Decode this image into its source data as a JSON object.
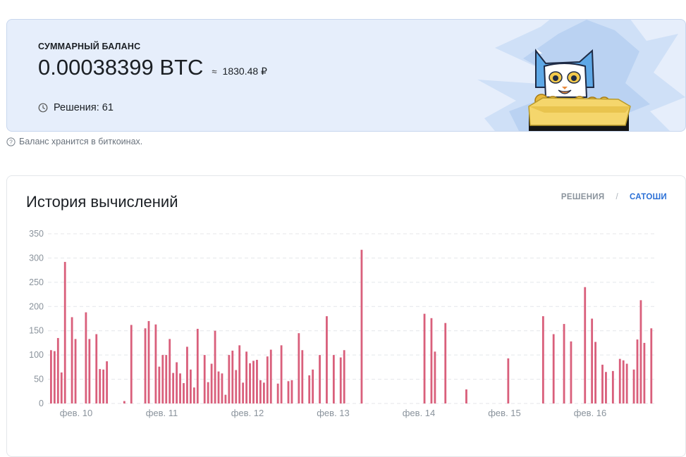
{
  "balance": {
    "label": "СУММАРНЫЙ БАЛАНС",
    "value": "0.00038399 BTC",
    "approx_sign": "≈",
    "fiat": "1830.48 ₽",
    "solutions": "Решения: 61"
  },
  "hint": "Баланс хранится в биткоинах.",
  "history": {
    "title": "История вычислений",
    "toggle_solutions": "РЕШЕНИЯ",
    "toggle_separator": "/",
    "toggle_satoshi": "САТОШИ"
  },
  "colors": {
    "bar": "#d95f7b",
    "accent": "#2a6fd6",
    "card_bg": "#e6eefb"
  },
  "icons": [
    "clock-icon",
    "question-circle-icon",
    "cat-mascot-icon"
  ],
  "chart_data": {
    "type": "bar",
    "ylim": [
      0,
      350
    ],
    "yticks": [
      0,
      50,
      100,
      150,
      200,
      250,
      300,
      350
    ],
    "grid": true,
    "xtick_labels": [
      "фев. 10",
      "фев. 11",
      "фев. 12",
      "фев. 13",
      "фев. 14",
      "фев. 15",
      "фев. 16"
    ],
    "series": [
      {
        "values": [
          110,
          108,
          135,
          64,
          292,
          0,
          178,
          133,
          0,
          0,
          188,
          133,
          0,
          143,
          71,
          70,
          87,
          0,
          0,
          0,
          0,
          5,
          0,
          162,
          0,
          0,
          0,
          155,
          170,
          0,
          163,
          76,
          100,
          100,
          133,
          63,
          85,
          62,
          42,
          117,
          70,
          33,
          154,
          0,
          100,
          44,
          82,
          150,
          66,
          62,
          18,
          100,
          109,
          69,
          120,
          43,
          107,
          83,
          88,
          90,
          48,
          43,
          97,
          111,
          0,
          41,
          120,
          0,
          46,
          48,
          0,
          145,
          110,
          0,
          58,
          70,
          0,
          100,
          0,
          180,
          0,
          100,
          0,
          95,
          110,
          0,
          0,
          0,
          0,
          317,
          0,
          0,
          0,
          0,
          0,
          0,
          0,
          0,
          0,
          0,
          0,
          0,
          0,
          0,
          0,
          0,
          0,
          185,
          0,
          176,
          107,
          0,
          0,
          166,
          0,
          0,
          0,
          0,
          0,
          29,
          0,
          0,
          0,
          0,
          0,
          0,
          0,
          0,
          0,
          0,
          0,
          93,
          0,
          0,
          0,
          0,
          0,
          0,
          0,
          0,
          0,
          180,
          0,
          0,
          143,
          0,
          0,
          164,
          0,
          128,
          0,
          0,
          0,
          240,
          0,
          175,
          127,
          0,
          80,
          65,
          0,
          67,
          0,
          92,
          89,
          82,
          0,
          70,
          132,
          213,
          125,
          0,
          155
        ]
      }
    ]
  }
}
